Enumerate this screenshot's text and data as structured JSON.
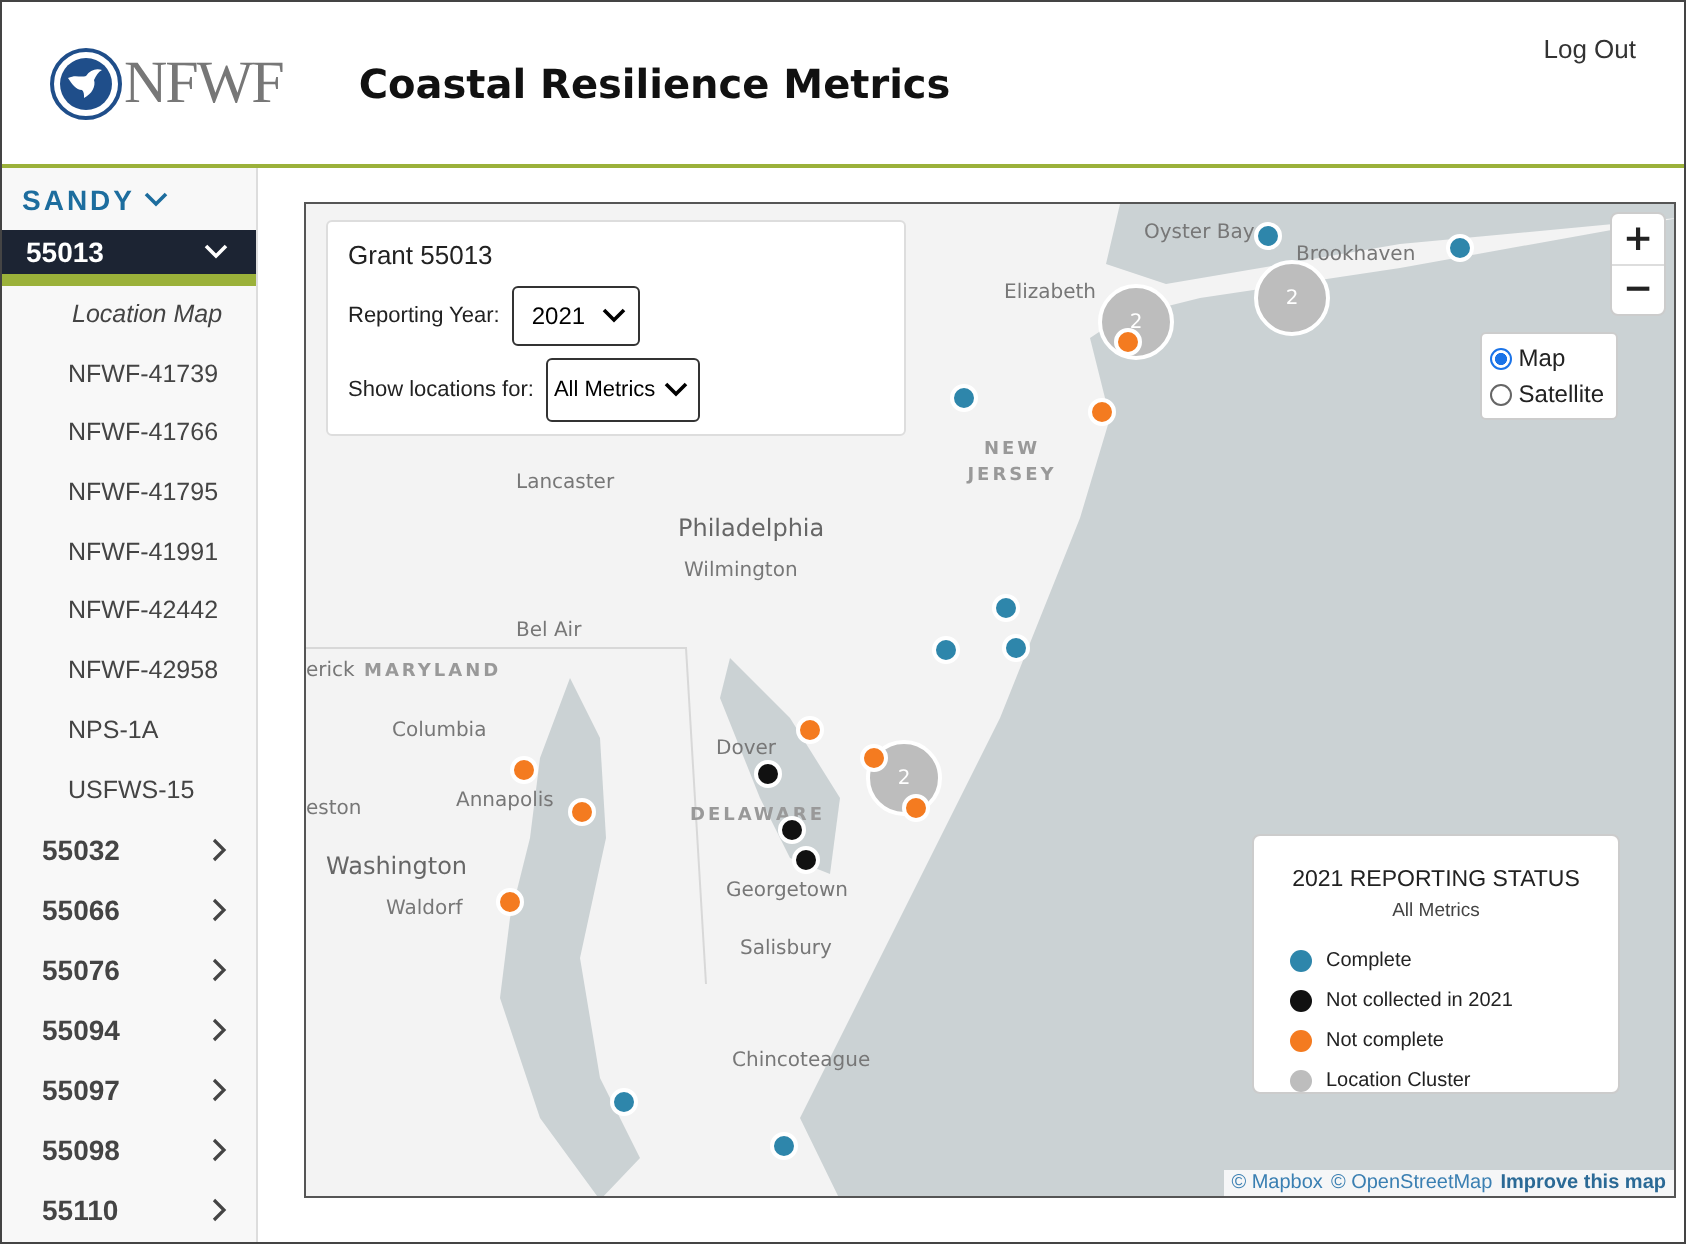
{
  "header": {
    "logo_text": "NFWF",
    "title": "Coastal Resilience Metrics",
    "logout": "Log Out"
  },
  "sidebar": {
    "program": {
      "label": "SANDY",
      "expanded": true
    },
    "grants": [
      {
        "label": "55013",
        "expanded": true,
        "selected": true,
        "children": [
          {
            "label": "Location Map",
            "selected": true
          },
          {
            "label": "NFWF-41739",
            "selected": false
          },
          {
            "label": "NFWF-41766",
            "selected": false
          },
          {
            "label": "NFWF-41795",
            "selected": false
          },
          {
            "label": "NFWF-41991",
            "selected": false
          },
          {
            "label": "NFWF-42442",
            "selected": false
          },
          {
            "label": "NFWF-42958",
            "selected": false
          },
          {
            "label": "NPS-1A",
            "selected": false
          },
          {
            "label": "USFWS-15",
            "selected": false
          }
        ]
      },
      {
        "label": "55032",
        "expanded": false,
        "selected": false
      },
      {
        "label": "55066",
        "expanded": false,
        "selected": false
      },
      {
        "label": "55076",
        "expanded": false,
        "selected": false
      },
      {
        "label": "55094",
        "expanded": false,
        "selected": false
      },
      {
        "label": "55097",
        "expanded": false,
        "selected": false
      },
      {
        "label": "55098",
        "expanded": false,
        "selected": false
      },
      {
        "label": "55110",
        "expanded": false,
        "selected": false
      }
    ]
  },
  "map": {
    "grant_panel": {
      "title": "Grant 55013",
      "year_label": "Reporting Year:",
      "year_value": "2021",
      "filter_label": "Show locations for:",
      "filter_value": "All Metrics"
    },
    "zoom_in": "+",
    "zoom_out": "−",
    "layers": [
      {
        "label": "Map",
        "selected": true
      },
      {
        "label": "Satellite",
        "selected": false
      }
    ],
    "places": [
      {
        "label": "Oyster Bay",
        "kind": "city"
      },
      {
        "label": "Brookhaven",
        "kind": "city"
      },
      {
        "label": "Elizabeth",
        "kind": "city"
      },
      {
        "label": "Lancaster",
        "kind": "city"
      },
      {
        "label": "NEW JERSEY",
        "kind": "state_wrap"
      },
      {
        "label": "Philadelphia",
        "kind": "bigcity"
      },
      {
        "label": "Wilmington",
        "kind": "city"
      },
      {
        "label": "Bel Air",
        "kind": "city"
      },
      {
        "label": "erick",
        "kind": "city"
      },
      {
        "label": "MARYLAND",
        "kind": "state"
      },
      {
        "label": "Columbia",
        "kind": "city"
      },
      {
        "label": "Dover",
        "kind": "city"
      },
      {
        "label": "eston",
        "kind": "city"
      },
      {
        "label": "Annapolis",
        "kind": "city"
      },
      {
        "label": "DELAWARE",
        "kind": "state"
      },
      {
        "label": "Washington",
        "kind": "bigcity"
      },
      {
        "label": "Waldorf",
        "kind": "city"
      },
      {
        "label": "Georgetown",
        "kind": "city"
      },
      {
        "label": "Salisbury",
        "kind": "city"
      },
      {
        "label": "Chincoteague",
        "kind": "city"
      }
    ],
    "clusters": [
      {
        "count": "2"
      },
      {
        "count": "2"
      },
      {
        "count": "2"
      }
    ],
    "markers": [
      {
        "kind": "complete"
      },
      {
        "kind": "complete"
      },
      {
        "kind": "complete"
      },
      {
        "kind": "complete"
      },
      {
        "kind": "complete"
      },
      {
        "kind": "complete"
      },
      {
        "kind": "complete"
      },
      {
        "kind": "complete"
      },
      {
        "kind": "not_complete"
      },
      {
        "kind": "not_complete"
      },
      {
        "kind": "not_complete"
      },
      {
        "kind": "not_complete"
      },
      {
        "kind": "not_complete"
      },
      {
        "kind": "not_complete"
      },
      {
        "kind": "not_complete"
      },
      {
        "kind": "not_complete"
      },
      {
        "kind": "not_collected"
      },
      {
        "kind": "not_collected"
      },
      {
        "kind": "not_collected"
      }
    ],
    "legend": {
      "title": "2021 REPORTING STATUS",
      "subtitle": "All Metrics",
      "items": [
        {
          "kind": "complete",
          "label": "Complete",
          "color": "#2e86ab"
        },
        {
          "kind": "not_collected",
          "label": "Not collected in 2021",
          "color": "#111111"
        },
        {
          "kind": "not_complete",
          "label": "Not complete",
          "color": "#f47b20"
        },
        {
          "kind": "cluster",
          "label": "Location Cluster",
          "color": "#bdbdbd"
        }
      ]
    },
    "attribution": [
      {
        "label": "© Mapbox",
        "kind": "link"
      },
      {
        "label": "© OpenStreetMap",
        "kind": "link"
      },
      {
        "label": "Improve this map",
        "kind": "strong"
      }
    ]
  }
}
